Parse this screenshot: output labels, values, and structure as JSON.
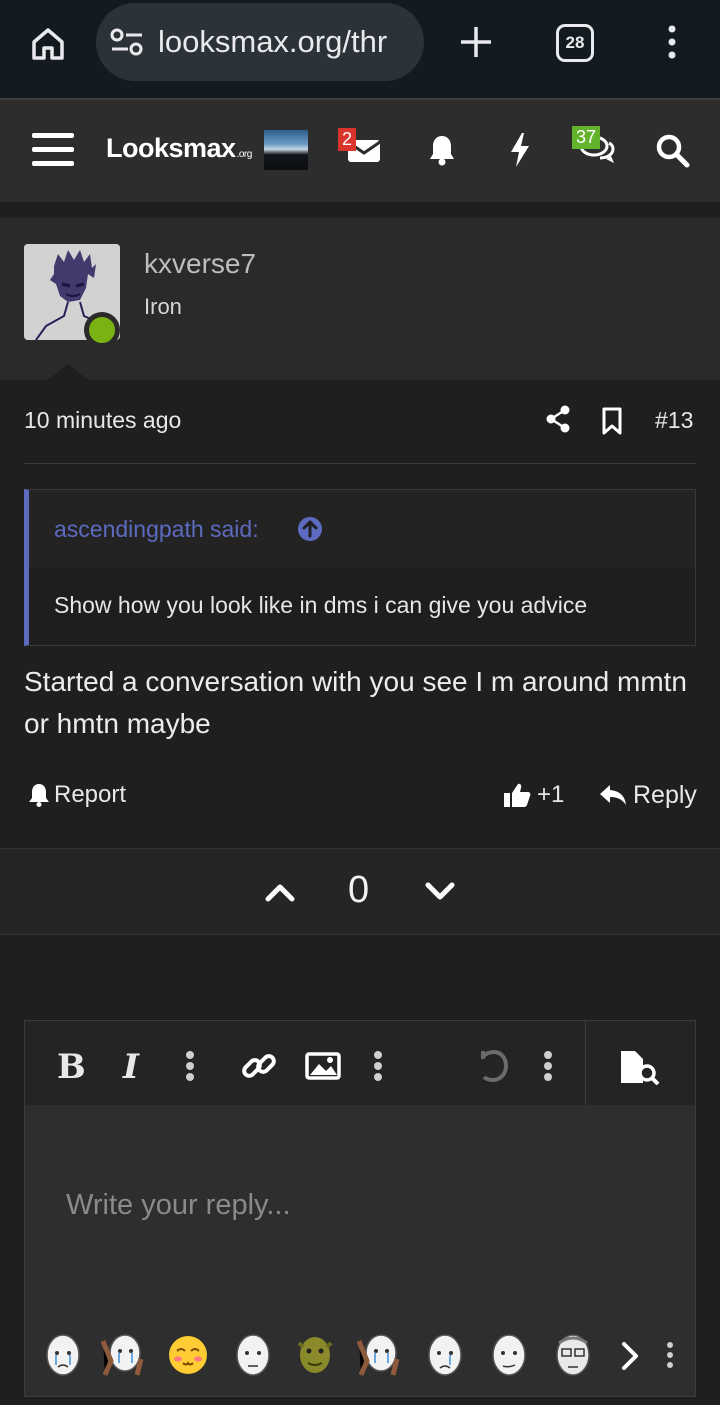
{
  "browser": {
    "url": "looksmax.org/thr",
    "tab_count": "28"
  },
  "site": {
    "logo_main": "Looksmax",
    "logo_suffix": ".org",
    "alerts": {
      "inbox_badge": "2",
      "conversations_badge": "37"
    }
  },
  "post": {
    "username": "kxverse7",
    "user_title": "Iron",
    "time": "10 minutes ago",
    "post_number": "#13",
    "quote": {
      "author": "ascendingpath said:",
      "text": "Show how you look like in dms i can give you advice"
    },
    "body": "Started a conversation with you see I m around mmtn or hmtn maybe",
    "actions": {
      "report": "Report",
      "like": "+1",
      "reply": "Reply"
    },
    "vote_count": "0"
  },
  "editor": {
    "bold_label": "B",
    "italic_label": "I",
    "placeholder": "Write your reply..."
  },
  "colors": {
    "accent_quote": "#5c6bc0",
    "online": "#7ab213",
    "badge_red": "#d9352d",
    "badge_green": "#64b32d"
  }
}
